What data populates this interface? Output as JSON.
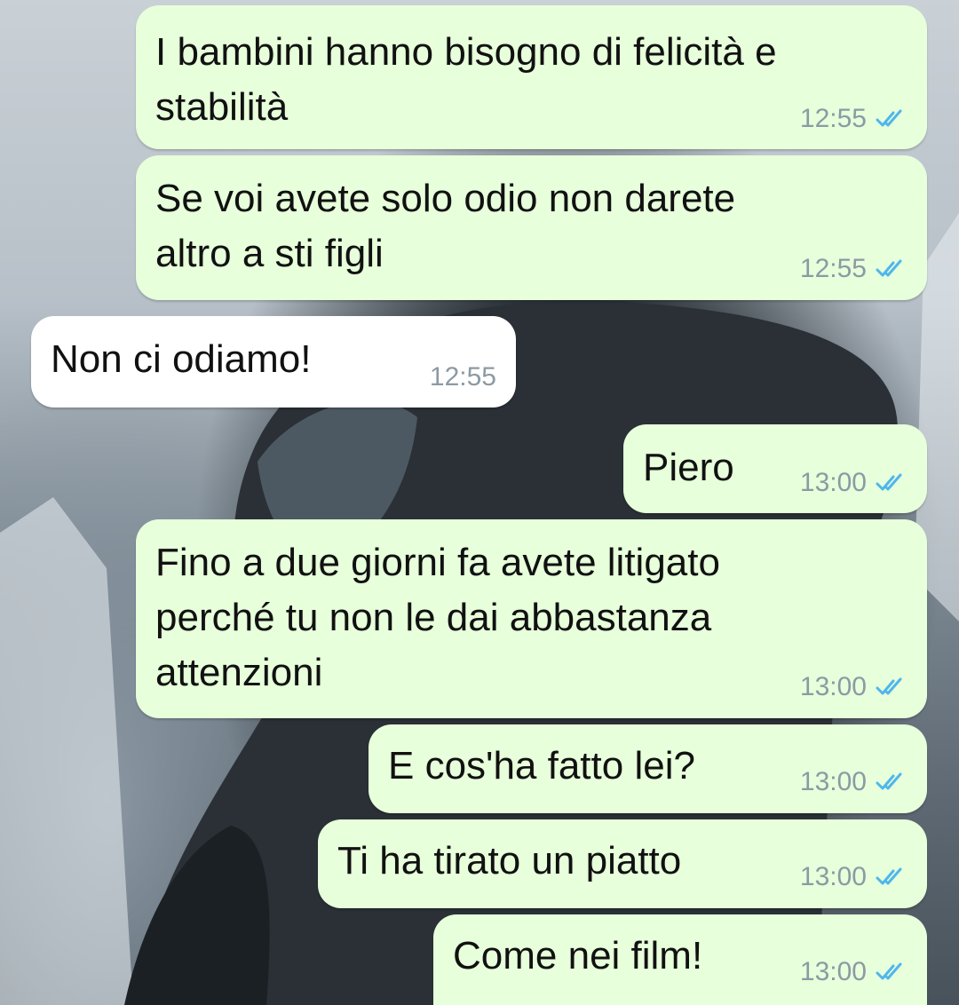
{
  "conversation": {
    "messages": [
      {
        "direction": "outgoing",
        "text": "I bambini hanno bisogno di felicità e\nstabilità",
        "time": "12:55",
        "status": "read-double-check-icon"
      },
      {
        "direction": "outgoing",
        "text": "Se voi avete solo odio non darete\naltro a sti figli",
        "time": "12:55",
        "status": "read-double-check-icon"
      },
      {
        "direction": "incoming",
        "text": "Non ci odiamo!",
        "time": "12:55"
      },
      {
        "direction": "outgoing",
        "text": "Piero",
        "time": "13:00",
        "status": "read-double-check-icon"
      },
      {
        "direction": "outgoing",
        "text": "Fino a due giorni fa avete litigato\nperché tu non le dai abbastanza\nattenzioni",
        "time": "13:00",
        "status": "read-double-check-icon"
      },
      {
        "direction": "outgoing",
        "text": "E cos'ha fatto lei?",
        "time": "13:00",
        "status": "read-double-check-icon"
      },
      {
        "direction": "outgoing",
        "text": "Ti ha tirato un piatto",
        "time": "13:00",
        "status": "read-double-check-icon"
      },
      {
        "direction": "outgoing",
        "text": "Come nei film!",
        "time": "13:00",
        "status": "read-double-check-icon"
      }
    ]
  },
  "theme": {
    "outgoing_bubble": "#e7ffdb",
    "incoming_bubble": "#ffffff",
    "read_tick_color": "#4fb6ec",
    "timestamp_color": "#8c9aa3"
  }
}
